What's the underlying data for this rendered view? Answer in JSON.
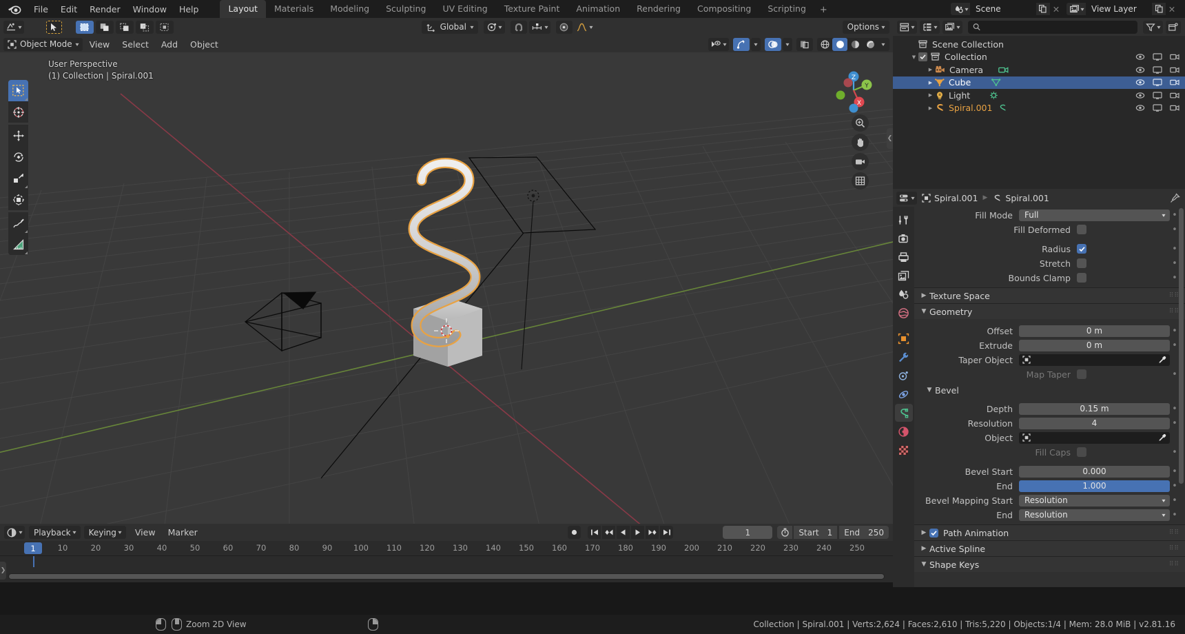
{
  "app": {
    "logo_icon": "blender-logo",
    "menus": [
      "File",
      "Edit",
      "Render",
      "Window",
      "Help"
    ],
    "workspaces": [
      "Layout",
      "Materials",
      "Modeling",
      "Sculpting",
      "UV Editing",
      "Texture Paint",
      "Animation",
      "Rendering",
      "Compositing",
      "Scripting"
    ],
    "active_workspace": "Layout",
    "add_workspace_label": "+",
    "scene": {
      "icon": "scene-icon",
      "name": "Scene",
      "new_icon": "duplicate-icon",
      "unlink_icon": "x-icon"
    },
    "view_layer": {
      "icon": "view-layer-icon",
      "name": "View Layer",
      "new_icon": "duplicate-icon",
      "unlink_icon": "x-icon"
    }
  },
  "viewport_header": {
    "editor_type_icon": "editor-type-icon",
    "cursor_icon": "cursor-select-icon",
    "select_modes": [
      "select-box-icon",
      "select-extend-icon",
      "select-subtract-icon",
      "select-invert-icon",
      "select-intersect-icon"
    ],
    "mode": "Object Mode",
    "menus": [
      "View",
      "Select",
      "Add",
      "Object"
    ],
    "transform_orientation": "Global",
    "pivot_icon": "pivot-point-icon",
    "snap_magnet_icon": "magnet-icon",
    "snap_icon": "snap-increment-icon",
    "proportional_icon": "proportional-edit-icon",
    "falloff_icon": "falloff-curve-icon",
    "options_label": "Options",
    "visibility_icon": "visibility-icon",
    "gizmo_icon": "gizmo-icon",
    "overlay_icon": "overlays-icon",
    "xray_icon": "xray-icon",
    "shading_modes": [
      "wireframe-icon",
      "solid-icon",
      "material-preview-icon",
      "rendered-icon"
    ],
    "active_shading": "solid-icon"
  },
  "viewport": {
    "perspective_label": "User Perspective",
    "scene_label": "(1) Collection | Spiral.001",
    "tools": [
      {
        "name": "tweak-tool",
        "active": true
      },
      {
        "name": "cursor-tool",
        "active": false
      },
      {
        "name": "move-tool",
        "active": false
      },
      {
        "name": "rotate-tool",
        "active": false
      },
      {
        "name": "scale-tool",
        "active": false
      },
      {
        "name": "transform-tool",
        "active": false
      },
      {
        "name": "annotate-tool",
        "active": false
      },
      {
        "name": "measure-tool",
        "active": false
      }
    ],
    "gizmo_axes": [
      "Z",
      "Y",
      "X"
    ],
    "nav_buttons": [
      "zoom-icon",
      "pan-hand-icon",
      "camera-view-icon",
      "toggle-ortho-icon"
    ]
  },
  "outliner": {
    "display_mode_icon": "outliner-display-mode-icon",
    "filter_id_icon": "filter-id-icon",
    "search_placeholder": "",
    "search_value": "",
    "filter_icon": "funnel-icon",
    "new_collection_icon": "new-collection-icon",
    "rows": [
      {
        "label": "Scene Collection",
        "icon": "collection-icon",
        "indent": 0,
        "disclosure": "",
        "checkbox": false,
        "selected": false,
        "color": "#d4d4d4",
        "data_icon": ""
      },
      {
        "label": "Collection",
        "icon": "collection-icon",
        "indent": 1,
        "disclosure": "down",
        "checkbox": true,
        "selected": false,
        "color": "#d4d4d4",
        "data_icon": ""
      },
      {
        "label": "Camera",
        "icon": "camera-object-icon",
        "indent": 2,
        "disclosure": "right",
        "checkbox": false,
        "selected": false,
        "color": "#d4d4d4",
        "data_icon": "camera-data-icon"
      },
      {
        "label": "Cube",
        "icon": "mesh-object-icon",
        "indent": 2,
        "disclosure": "right",
        "checkbox": false,
        "selected": true,
        "color": "#ffffff",
        "data_icon": "mesh-data-icon"
      },
      {
        "label": "Light",
        "icon": "light-object-icon",
        "indent": 2,
        "disclosure": "right",
        "checkbox": false,
        "selected": false,
        "color": "#d4d4d4",
        "data_icon": "light-data-icon"
      },
      {
        "label": "Spiral.001",
        "icon": "curve-object-icon",
        "indent": 2,
        "disclosure": "right",
        "checkbox": false,
        "selected": false,
        "color": "#e8a243",
        "data_icon": "curve-data-icon"
      }
    ],
    "row_toggles": [
      "eye-icon",
      "screen-icon",
      "camera-render-icon"
    ]
  },
  "properties": {
    "editor_icon": "properties-editor-icon",
    "breadcrumb": [
      {
        "icon": "object-icon",
        "label": "Spiral.001"
      },
      {
        "icon": "curve-data-icon",
        "label": "Spiral.001"
      }
    ],
    "pin_icon": "pin-icon",
    "tabs": [
      {
        "name": "tool-tab",
        "icon": "tool-icon",
        "color": "#d0d0d0",
        "active": false
      },
      {
        "name": "render-tab",
        "icon": "render-icon",
        "color": "#d0d0d0",
        "active": false
      },
      {
        "name": "output-tab",
        "icon": "printer-icon",
        "color": "#d0d0d0",
        "active": false
      },
      {
        "name": "view-layer-tab",
        "icon": "images-icon",
        "color": "#d0d0d0",
        "active": false
      },
      {
        "name": "scene-tab",
        "icon": "scene-props-icon",
        "color": "#d0d0d0",
        "active": false
      },
      {
        "name": "world-tab",
        "icon": "world-icon",
        "color": "#d06e80",
        "active": false
      },
      {
        "name": "object-tab",
        "icon": "object-props-icon",
        "color": "#e8912e",
        "active": false
      },
      {
        "name": "modifier-tab",
        "icon": "wrench-icon",
        "color": "#5b8ed0",
        "active": false
      },
      {
        "name": "particles-tab",
        "icon": "particles-icon",
        "color": "#8fb3e0",
        "active": false
      },
      {
        "name": "physics-tab",
        "icon": "physics-icon",
        "color": "#7da5e8",
        "active": false
      },
      {
        "name": "object-data-tab",
        "icon": "curve-data-icon",
        "color": "#4ec28f",
        "active": true
      },
      {
        "name": "material-tab",
        "icon": "material-icon",
        "color": "#d4546b",
        "active": false
      },
      {
        "name": "texture-tab",
        "icon": "texture-checker-icon",
        "color": "#d46b6b",
        "active": false
      }
    ],
    "fields": {
      "fill_mode_label": "Fill Mode",
      "fill_mode_value": "Full",
      "fill_deformed_label": "Fill Deformed",
      "fill_deformed_checked": false,
      "radius_label": "Radius",
      "radius_checked": true,
      "stretch_label": "Stretch",
      "stretch_checked": false,
      "bounds_clamp_label": "Bounds Clamp",
      "bounds_clamp_checked": false,
      "texture_space_panel": "Texture Space",
      "geometry_panel": "Geometry",
      "offset_label": "Offset",
      "offset_value": "0 m",
      "extrude_label": "Extrude",
      "extrude_value": "0 m",
      "taper_object_label": "Taper Object",
      "taper_object_value": "",
      "map_taper_label": "Map Taper",
      "map_taper_checked": false,
      "bevel_panel": "Bevel",
      "depth_label": "Depth",
      "depth_value": "0.15 m",
      "resolution_label": "Resolution",
      "resolution_value": "4",
      "bevel_object_label": "Object",
      "bevel_object_value": "",
      "fill_caps_label": "Fill Caps",
      "fill_caps_checked": false,
      "bevel_start_label": "Bevel Start",
      "bevel_start_value": "0.000",
      "bevel_end_label": "End",
      "bevel_end_value": "1.000",
      "bevel_mapping_start_label": "Bevel Mapping Start",
      "bevel_mapping_start_value": "Resolution",
      "bevel_mapping_end_label": "End",
      "bevel_mapping_end_value": "Resolution",
      "path_animation_panel": "Path Animation",
      "path_animation_checked": true,
      "active_spline_panel": "Active Spline",
      "shape_keys_panel": "Shape Keys"
    }
  },
  "timeline": {
    "editor_icon": "timeline-editor-icon",
    "menus": [
      "Playback",
      "Keying",
      "View",
      "Marker"
    ],
    "playback_controls": [
      "record-icon",
      "jump-start-icon",
      "prev-keyframe-icon",
      "play-reverse-icon",
      "play-icon",
      "next-keyframe-icon",
      "jump-end-icon"
    ],
    "current_frame": "1",
    "auto_key_icon": "stopwatch-icon",
    "start_label": "Start",
    "start_value": "1",
    "end_label": "End",
    "end_value": "250",
    "ticks": [
      10,
      20,
      30,
      40,
      50,
      60,
      70,
      80,
      90,
      100,
      110,
      120,
      130,
      140,
      150,
      160,
      170,
      180,
      190,
      200,
      210,
      220,
      230,
      240,
      250
    ],
    "playhead_frame": "1"
  },
  "statusbar": {
    "keymap": [
      {
        "mouse": "select-mouse-icon",
        "label": ""
      },
      {
        "mouse": "middle-mouse-icon",
        "label": "Zoom 2D View"
      },
      {
        "mouse": "right-mouse-icon",
        "label": ""
      }
    ],
    "zoom_label": "Zoom 2D View",
    "scene_stats": "Collection | Spiral.001 | Verts:2,624 | Faces:2,610 | Tris:5,220 | Objects:1/4 | Mem: 28.0 MiB | v2.81.16"
  },
  "colors": {
    "accent_blue": "#4772b3",
    "select_orange": "#e8a243",
    "viewport_bg": "#393939",
    "panel_bg": "#303030",
    "header_bg": "#1d1d1d",
    "outliner_bg": "#282828"
  }
}
